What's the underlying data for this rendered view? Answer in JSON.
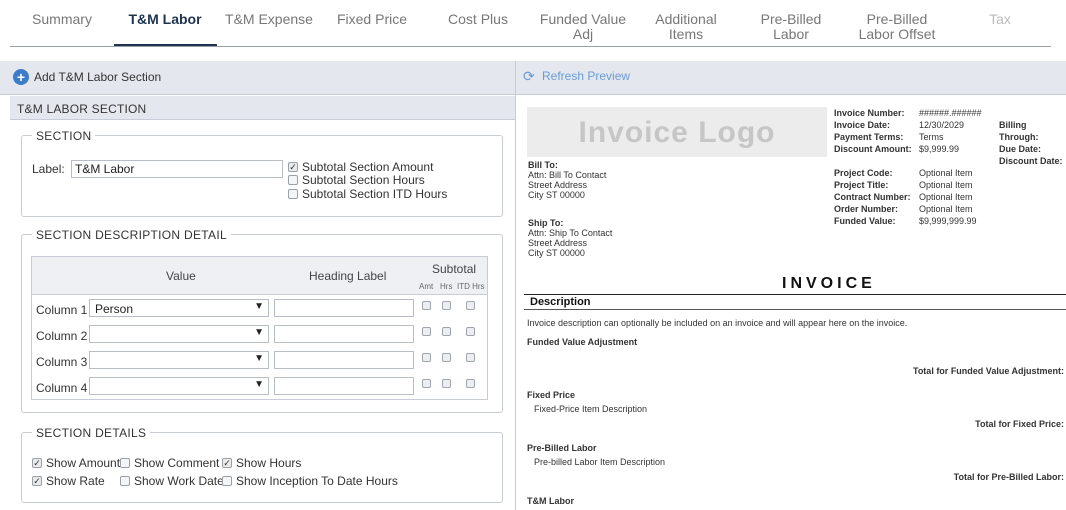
{
  "tabs": [
    {
      "label": "Summary"
    },
    {
      "label": "T&M Labor"
    },
    {
      "label": "T&M Expense"
    },
    {
      "label": "Fixed Price"
    },
    {
      "label": "Cost Plus"
    },
    {
      "label": "Funded Value Adj"
    },
    {
      "label": "Additional Items"
    },
    {
      "label": "Pre-Billed Labor"
    },
    {
      "label": "Pre-Billed Labor Offset"
    },
    {
      "label": "Tax"
    }
  ],
  "toolbar": {
    "add_label": "Add T&M Labor Section",
    "refresh_label": "Refresh Preview"
  },
  "section_header": "T&M LABOR SECTION",
  "section": {
    "legend": "SECTION",
    "label_caption": "Label:",
    "label_value": "T&M Labor",
    "options": [
      {
        "label": "Subtotal Section Amount",
        "checked": true
      },
      {
        "label": "Subtotal Section Hours",
        "checked": false
      },
      {
        "label": "Subtotal Section ITD Hours",
        "checked": false
      }
    ]
  },
  "description_detail": {
    "legend": "SECTION DESCRIPTION DETAIL",
    "col_value": "Value",
    "col_heading": "Heading Label",
    "col_subtotal": "Subtotal",
    "sub_amt": "Amt",
    "sub_hrs": "Hrs",
    "sub_itd": "ITD Hrs",
    "rows": [
      {
        "label": "Column 1",
        "value": "Person"
      },
      {
        "label": "Column 2",
        "value": ""
      },
      {
        "label": "Column 3",
        "value": ""
      },
      {
        "label": "Column 4",
        "value": ""
      }
    ]
  },
  "section_details": {
    "legend": "SECTION DETAILS",
    "show_amount": "Show Amount",
    "show_comment": "Show Comment",
    "show_hours": "Show Hours",
    "show_rate": "Show Rate",
    "show_work_date": "Show Work Date",
    "show_itd_hours": "Show Inception To Date Hours"
  },
  "invoice": {
    "logo": "Invoice Logo",
    "bill_to_label": "Bill To:",
    "bill_to_lines": [
      "Attn: Bill To Contact",
      "Street Address",
      "City ST 00000"
    ],
    "ship_to_label": "Ship To:",
    "ship_to_lines": [
      "Attn: Ship To Contact",
      "Street Address",
      "City ST 00000"
    ],
    "invoice_number_label": "Invoice Number:",
    "invoice_number": "######.######",
    "invoice_date_label": "Invoice Date:",
    "invoice_date": "12/30/2029",
    "payment_terms_label": "Payment Terms:",
    "payment_terms": "Terms",
    "discount_amount_label": "Discount Amount:",
    "discount_amount": "$9,999.99",
    "billing_through_label": "Billing Through:",
    "due_date_label": "Due Date:",
    "discount_date_label": "Discount Date:",
    "project_code_label": "Project Code:",
    "project_code": "Optional Item",
    "project_title_label": "Project Title:",
    "project_title": "Optional Item",
    "contract_number_label": "Contract Number:",
    "contract_number": "Optional Item",
    "order_number_label": "Order Number:",
    "order_number": "Optional Item",
    "funded_value_label": "Funded Value:",
    "funded_value": "$9,999,999.99",
    "title": "INVOICE",
    "description_label": "Description",
    "description_text": "Invoice description can optionally be included on an invoice and will appear here on the invoice.",
    "funded_adj_label": "Funded Value Adjustment",
    "funded_adj_total": "Total for Funded Value Adjustment:",
    "fixed_price_label": "Fixed Price",
    "fixed_price_item": "Fixed-Price Item Description",
    "fixed_price_total": "Total for Fixed Price:",
    "prebilled_label": "Pre-Billed Labor",
    "prebilled_item": "Pre-billed Labor Item Description",
    "prebilled_total": "Total for Pre-Billed Labor:",
    "tm_labor_label": "T&M Labor"
  }
}
